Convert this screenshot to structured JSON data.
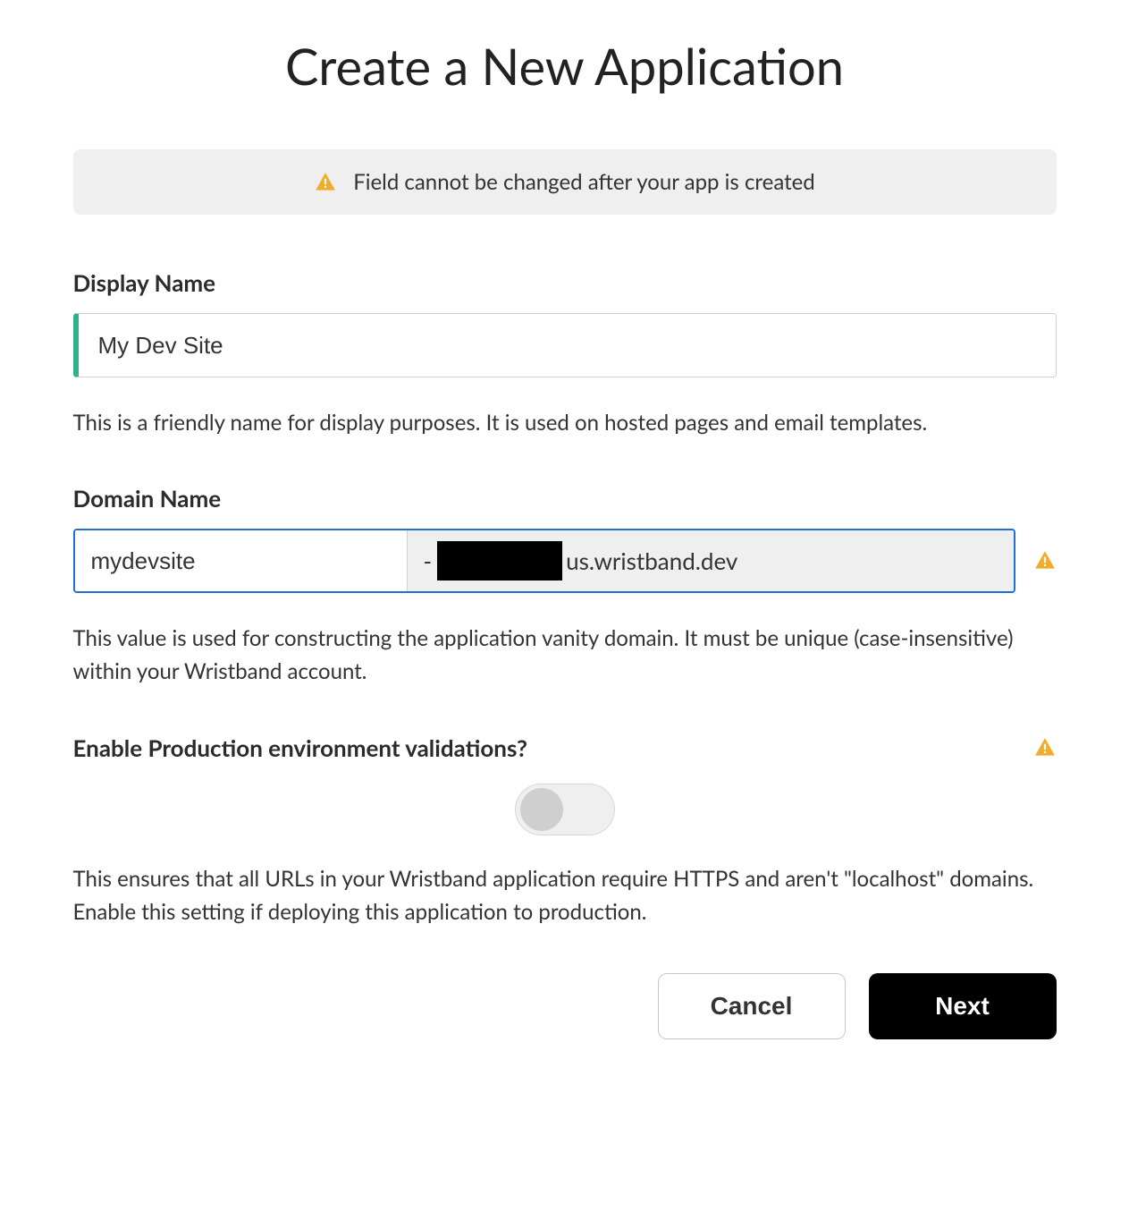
{
  "title": "Create a New Application",
  "banner": {
    "message": "Field cannot be changed after your app is created"
  },
  "fields": {
    "displayName": {
      "label": "Display Name",
      "value": "My Dev Site",
      "helper": "This is a friendly name for display purposes. It is used on hosted pages and email templates."
    },
    "domainName": {
      "label": "Domain Name",
      "value": "mydevsite",
      "suffix": "us.wristband.dev",
      "helper": "This value is used for constructing the application vanity domain. It must be unique (case-insensitive) within your Wristband account."
    },
    "productionValidations": {
      "label": "Enable Production environment validations?",
      "enabled": false,
      "helper": "This ensures that all URLs in your Wristband application require HTTPS and aren't \"localhost\" domains. Enable this setting if deploying this application to production."
    }
  },
  "actions": {
    "cancel": "Cancel",
    "next": "Next"
  },
  "colors": {
    "accent": "#2db28a",
    "focus": "#1e6fd9",
    "warning": "#f0ad2b"
  }
}
